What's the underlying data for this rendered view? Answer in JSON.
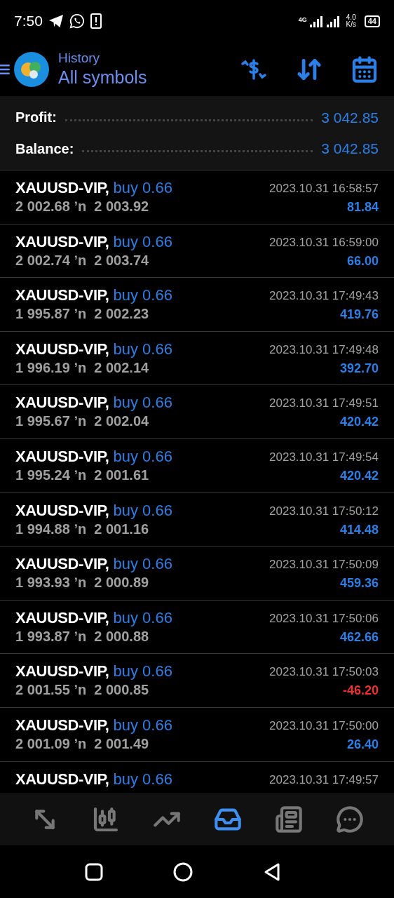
{
  "status_bar": {
    "time": "7:50",
    "network": "4G",
    "speed": "4.0 K/s",
    "battery": "44"
  },
  "header": {
    "title": "History",
    "subtitle": "All symbols"
  },
  "summary": [
    {
      "label": "Profit:",
      "value": "3 042.85"
    },
    {
      "label": "Balance:",
      "value": "3 042.85"
    }
  ],
  "deals": [
    {
      "symbol": "XAUUSD-VIP,",
      "type": "buy 0.66",
      "prices": "2 002.68 ʼn  2 003.92",
      "time": "2023.10.31 16:58:57",
      "profit": "81.84",
      "negative": false
    },
    {
      "symbol": "XAUUSD-VIP,",
      "type": "buy 0.66",
      "prices": "2 002.74 ʼn  2 003.74",
      "time": "2023.10.31 16:59:00",
      "profit": "66.00",
      "negative": false
    },
    {
      "symbol": "XAUUSD-VIP,",
      "type": "buy 0.66",
      "prices": "1 995.87 ʼn  2 002.23",
      "time": "2023.10.31 17:49:43",
      "profit": "419.76",
      "negative": false
    },
    {
      "symbol": "XAUUSD-VIP,",
      "type": "buy 0.66",
      "prices": "1 996.19 ʼn  2 002.14",
      "time": "2023.10.31 17:49:48",
      "profit": "392.70",
      "negative": false
    },
    {
      "symbol": "XAUUSD-VIP,",
      "type": "buy 0.66",
      "prices": "1 995.67 ʼn  2 002.04",
      "time": "2023.10.31 17:49:51",
      "profit": "420.42",
      "negative": false
    },
    {
      "symbol": "XAUUSD-VIP,",
      "type": "buy 0.66",
      "prices": "1 995.24 ʼn  2 001.61",
      "time": "2023.10.31 17:49:54",
      "profit": "420.42",
      "negative": false
    },
    {
      "symbol": "XAUUSD-VIP,",
      "type": "buy 0.66",
      "prices": "1 994.88 ʼn  2 001.16",
      "time": "2023.10.31 17:50:12",
      "profit": "414.48",
      "negative": false
    },
    {
      "symbol": "XAUUSD-VIP,",
      "type": "buy 0.66",
      "prices": "1 993.93 ʼn  2 000.89",
      "time": "2023.10.31 17:50:09",
      "profit": "459.36",
      "negative": false
    },
    {
      "symbol": "XAUUSD-VIP,",
      "type": "buy 0.66",
      "prices": "1 993.87 ʼn  2 000.88",
      "time": "2023.10.31 17:50:06",
      "profit": "462.66",
      "negative": false
    },
    {
      "symbol": "XAUUSD-VIP,",
      "type": "buy 0.66",
      "prices": "2 001.55 ʼn  2 000.85",
      "time": "2023.10.31 17:50:03",
      "profit": "-46.20",
      "negative": true
    },
    {
      "symbol": "XAUUSD-VIP,",
      "type": "buy 0.66",
      "prices": "2 001.09 ʼn  2 001.49",
      "time": "2023.10.31 17:50:00",
      "profit": "26.40",
      "negative": false
    },
    {
      "symbol": "XAUUSD-VIP,",
      "type": "buy 0.66",
      "time": "2023.10.31 17:49:57"
    }
  ],
  "bottom_nav": [
    {
      "kind": "quotes",
      "selected": false
    },
    {
      "kind": "chart",
      "selected": false
    },
    {
      "kind": "trade",
      "selected": false
    },
    {
      "kind": "history",
      "selected": true
    },
    {
      "kind": "news",
      "selected": false
    },
    {
      "kind": "messages",
      "selected": false
    }
  ]
}
